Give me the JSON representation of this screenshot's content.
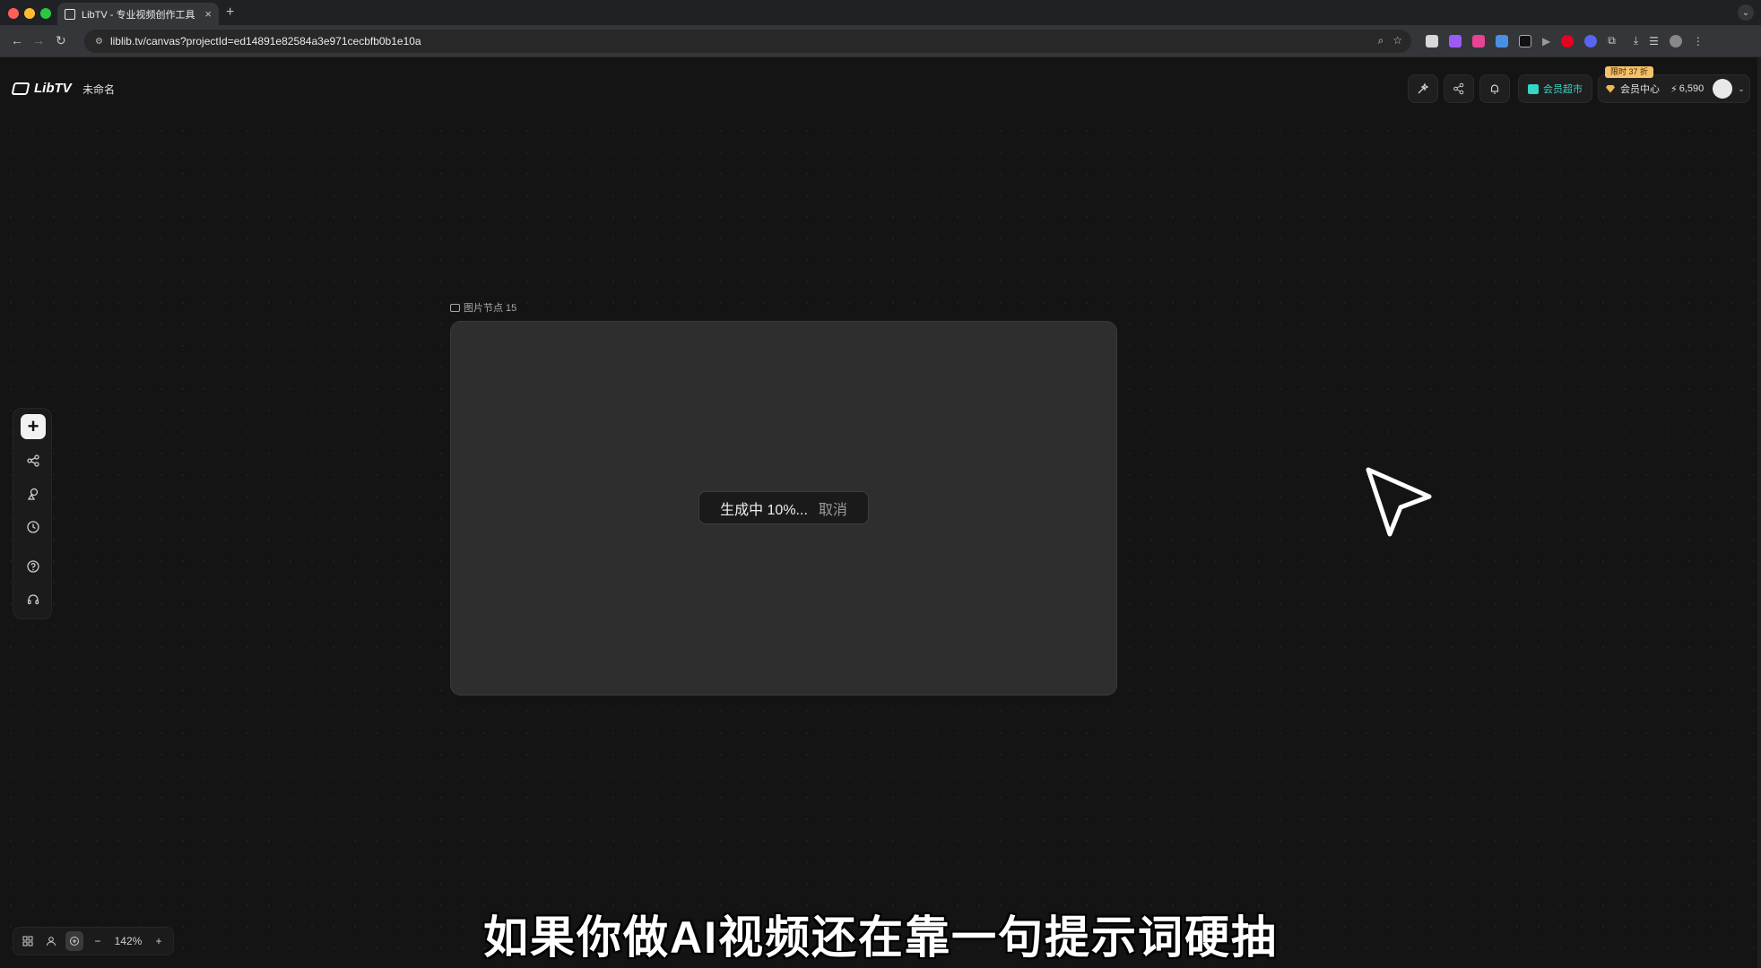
{
  "browser": {
    "tab_title": "LibTV - 专业视频创作工具",
    "tab_close": "×",
    "new_tab": "+",
    "url": "liblib.tv/canvas?projectId=ed14891e82584a3e971cecbfb0b1e10a"
  },
  "header": {
    "logo_text": "LibTV",
    "doc_title": "未命名",
    "market_label": "会员超市",
    "promo_badge": "限时 37 折",
    "member_center": "会员中心",
    "credits": "6,590"
  },
  "canvas": {
    "node_label": "图片节点 15",
    "progress_text": "生成中 10%...",
    "cancel_label": "取消",
    "progress_percent": 10
  },
  "zoom": {
    "minus": "−",
    "level": "142%",
    "plus": "+"
  },
  "toolbar": {
    "add": "+"
  },
  "subtitle": "如果你做AI视频还在靠一句提示词硬抽",
  "colors": {
    "accent": "#35d5c8",
    "promo": "#f5c26b",
    "background": "#141414",
    "node": "#2e2e2e"
  }
}
